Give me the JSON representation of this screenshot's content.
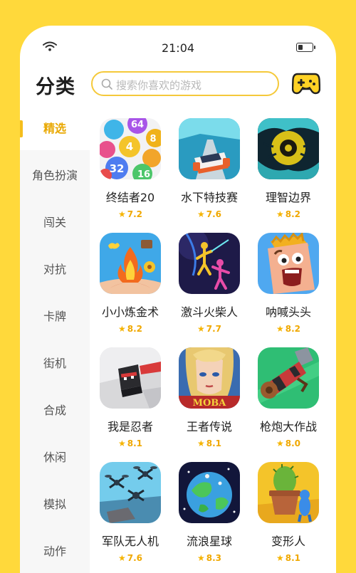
{
  "status_bar": {
    "time": "21:04"
  },
  "header": {
    "title": "分类",
    "search_placeholder": "搜索你喜欢的游戏"
  },
  "sidebar": {
    "items": [
      {
        "label": "精选",
        "active": true
      },
      {
        "label": "角色扮演",
        "active": false
      },
      {
        "label": "闯关",
        "active": false
      },
      {
        "label": "对抗",
        "active": false
      },
      {
        "label": "卡牌",
        "active": false
      },
      {
        "label": "街机",
        "active": false
      },
      {
        "label": "合成",
        "active": false
      },
      {
        "label": "休闲",
        "active": false
      },
      {
        "label": "模拟",
        "active": false
      },
      {
        "label": "动作",
        "active": false
      }
    ]
  },
  "games": [
    {
      "name": "终结者20",
      "rating": "7.2",
      "icon": "number-balls-icon"
    },
    {
      "name": "水下特技赛",
      "rating": "7.6",
      "icon": "race-car-icon"
    },
    {
      "name": "理智边界",
      "rating": "8.2",
      "icon": "yellow-eye-icon"
    },
    {
      "name": "小小炼金术",
      "rating": "8.2",
      "icon": "alchemy-fire-icon"
    },
    {
      "name": "激斗火柴人",
      "rating": "7.7",
      "icon": "stickman-icon"
    },
    {
      "name": "呐喊头头",
      "rating": "8.2",
      "icon": "shouting-head-icon"
    },
    {
      "name": "我是忍者",
      "rating": "8.1",
      "icon": "ninja-cube-icon"
    },
    {
      "name": "王者传说",
      "rating": "8.1",
      "icon": "heroine-icon"
    },
    {
      "name": "枪炮大作战",
      "rating": "8.0",
      "icon": "cannon-icon"
    },
    {
      "name": "军队无人机",
      "rating": "7.6",
      "icon": "drones-icon"
    },
    {
      "name": "流浪星球",
      "rating": "8.3",
      "icon": "planet-icon"
    },
    {
      "name": "变形人",
      "rating": "8.1",
      "icon": "cactus-pot-icon"
    }
  ],
  "game_icon_text": {
    "moba_logo": "MOBA",
    "balls": [
      "64",
      "4",
      "8",
      "32",
      "16"
    ]
  },
  "colors": {
    "accent": "#F5BE1D",
    "background": "#FFD93B",
    "active_text": "#E9A800"
  }
}
